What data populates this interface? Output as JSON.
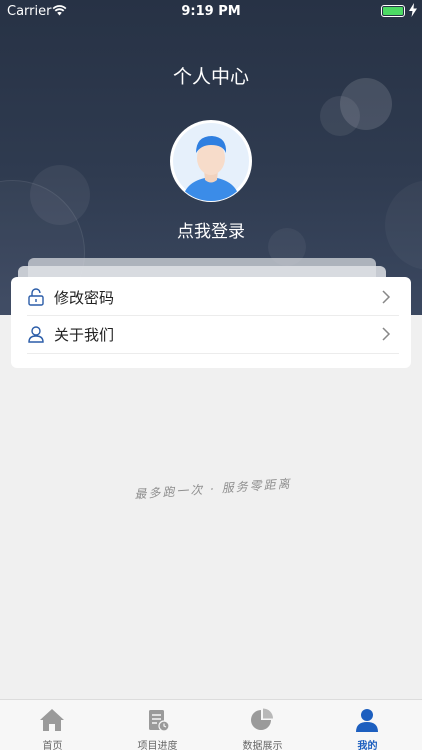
{
  "status_bar": {
    "carrier": "Carrier",
    "time": "9:19 PM"
  },
  "header": {
    "title": "个人中心",
    "login_prompt": "点我登录"
  },
  "menu": {
    "items": [
      {
        "label": "修改密码",
        "icon": "lock-icon"
      },
      {
        "label": "关于我们",
        "icon": "person-icon"
      }
    ]
  },
  "slogan": "最多跑一次 · 服务零距离",
  "tabbar": {
    "active_index": 3,
    "tabs": [
      {
        "label": "首页",
        "icon": "home-icon"
      },
      {
        "label": "项目进度",
        "icon": "progress-icon"
      },
      {
        "label": "数据展示",
        "icon": "pie-chart-icon"
      },
      {
        "label": "我的",
        "icon": "user-icon"
      }
    ]
  },
  "colors": {
    "header_bg": "#2f3b50",
    "accent": "#1d5fbf",
    "tab_inactive": "#999999",
    "battery": "#4cd964"
  }
}
